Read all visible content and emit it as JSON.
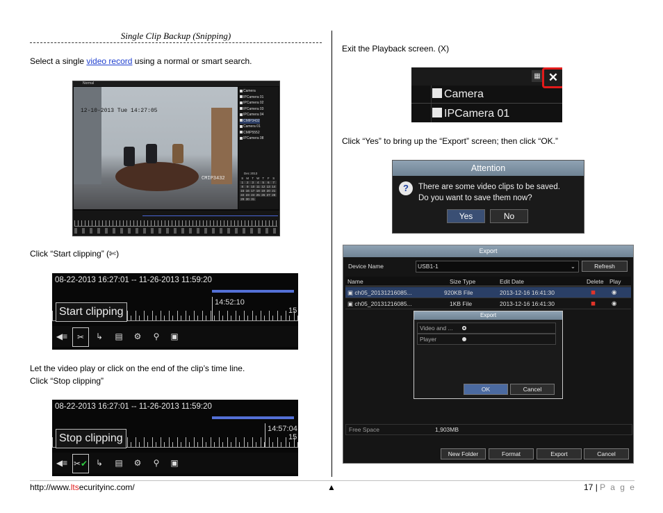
{
  "left": {
    "heading": "Single Clip Backup (Snipping)",
    "step1_prefix": "Select a single ",
    "step1_link": "video record",
    "step1_suffix": " using a normal or smart search.",
    "step2": "Click “Start clipping” (",
    "step2_glyph": "✄",
    "step2_end": ")",
    "step3_line1": "Let the video play or click on the end of the clip’s time line.",
    "step3_line2": "Click “Stop clipping”"
  },
  "playback": {
    "mode": "Normal",
    "timestamp": "12-10-2013 Tue 14:27:05",
    "camera_label": "CMIP3432",
    "cameras": [
      "Camera",
      "IPCamera 01",
      "IPCamera 02",
      "IPCamera 03",
      "IPCamera 04",
      "CMIP3432",
      "Camera 01",
      "CMIP5552",
      "IPCamera 08"
    ],
    "selected_camera_index": 5,
    "calendar_header": "Dec  2013",
    "weekdays": [
      "S",
      "M",
      "T",
      "W",
      "T",
      "F",
      "S"
    ],
    "days": [
      "1",
      "2",
      "3",
      "4",
      "5",
      "6",
      "7",
      "8",
      "9",
      "10",
      "11",
      "12",
      "13",
      "14",
      "15",
      "16",
      "17",
      "18",
      "19",
      "20",
      "21",
      "22",
      "23",
      "24",
      "25",
      "26",
      "27",
      "28",
      "29",
      "30",
      "31"
    ]
  },
  "clip_start": {
    "range": "08-22-2013 16:27:01 -- 11-26-2013 11:59:20",
    "time": "14:52:10",
    "tick_number": "15",
    "label": "Start clipping"
  },
  "clip_stop": {
    "range": "08-22-2013 16:27:01 -- 11-26-2013 11:59:20",
    "time": "14:57:04",
    "tick_number": "15",
    "label": "Stop clipping"
  },
  "right": {
    "step1": "Exit the Playback screen. (X)",
    "step2": "Click “Yes” to bring up the “Export” screen; then click “OK.”"
  },
  "exit_ui": {
    "row1": "Camera",
    "row2": "IPCamera 01",
    "close_glyph": "✕"
  },
  "attention": {
    "title": "Attention",
    "line1": "There are some video clips to be saved.",
    "line2": "Do you want to save them now?",
    "yes": "Yes",
    "no": "No"
  },
  "export": {
    "title": "Export",
    "device_label": "Device Name",
    "device_value": "USB1-1",
    "refresh": "Refresh",
    "columns": [
      "Name",
      "Size Type",
      "Edit Date",
      "Delete",
      "Play"
    ],
    "rows": [
      {
        "name": "ch05_20131216085...",
        "size": "920KB File",
        "date": "2013-12-16 16:41:30"
      },
      {
        "name": "ch05_20131216085...",
        "size": "1KB File",
        "date": "2013-12-16 16:41:30"
      }
    ],
    "sub_title": "Export",
    "opt1": "Video and ...",
    "opt2": "Player",
    "ok": "OK",
    "cancel": "Cancel",
    "free_label": "Free Space",
    "free_value": "1,903MB",
    "buttons": [
      "New Folder",
      "Format",
      "Export",
      "Cancel"
    ]
  },
  "footer": {
    "url_prefix": "http://www.",
    "url_red": "lts",
    "url_suffix": "ecurityinc.com/",
    "arrow": "▲",
    "page_num": "17",
    "sep": " | ",
    "page_word": "P a g e"
  },
  "colors": {
    "link": "#1f3fcf",
    "brand_red": "#e02020",
    "exit_highlight": "#e21a1a",
    "timeline_blue": "#5470d6",
    "selection": "#2a3f66"
  }
}
